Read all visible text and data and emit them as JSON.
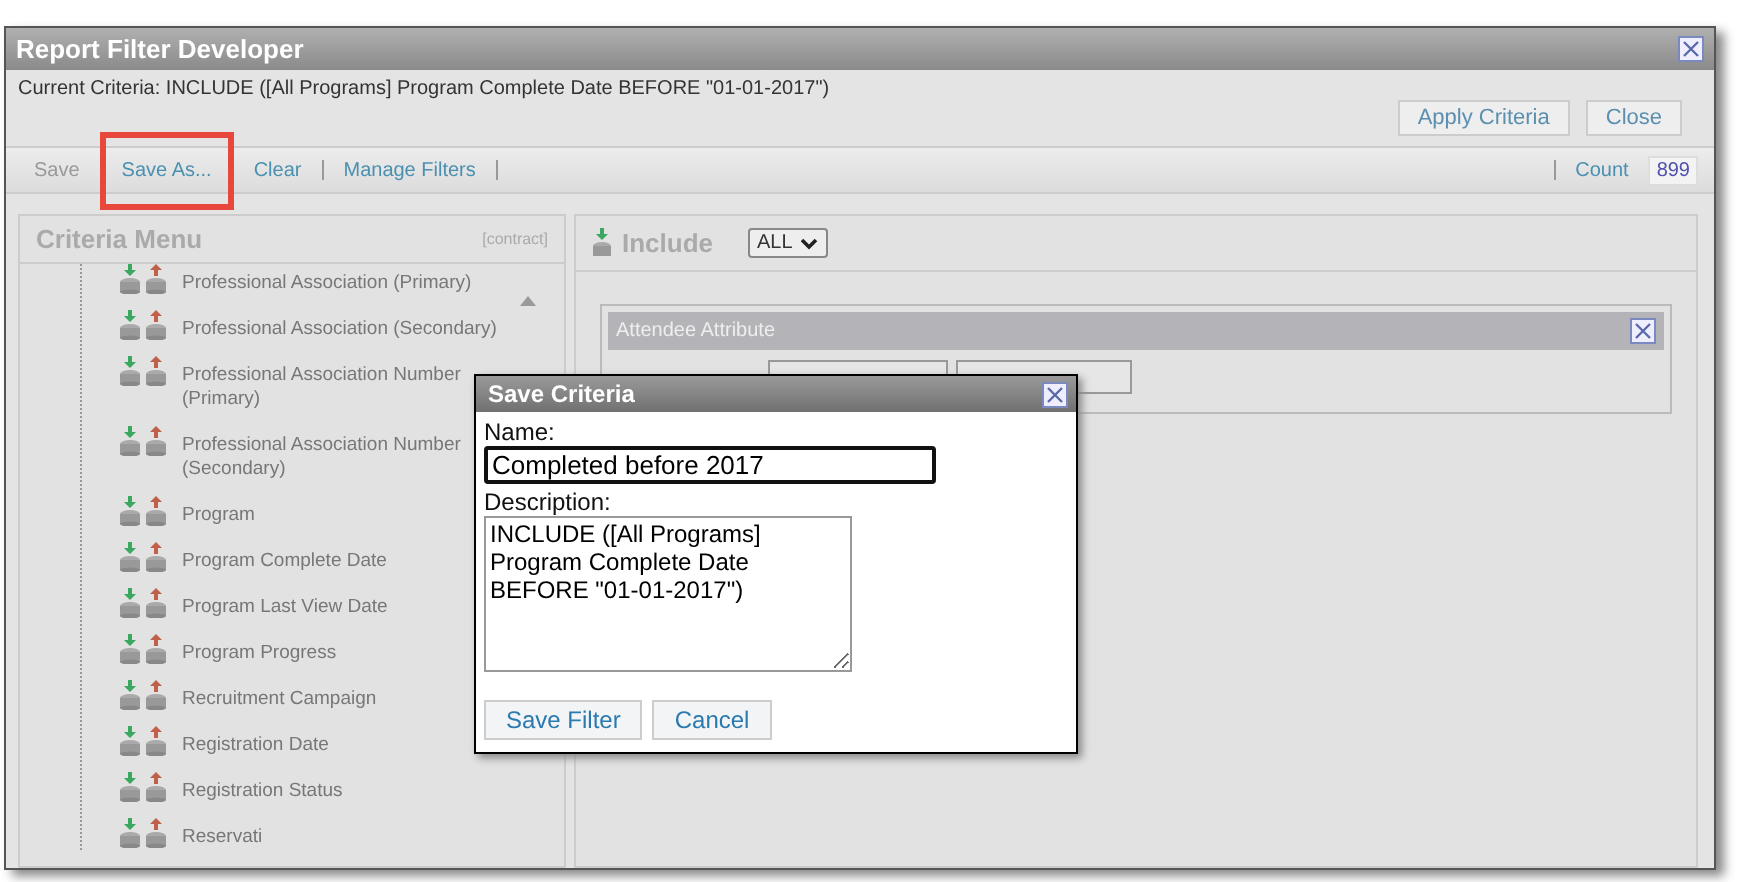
{
  "window": {
    "title": "Report Filter Developer"
  },
  "criteria": {
    "label": "Current Criteria:",
    "value": "INCLUDE ([All Programs] Program Complete Date BEFORE \"01-01-2017\")"
  },
  "header_buttons": [
    "Apply Criteria",
    "Close"
  ],
  "toolbar": {
    "links": [
      {
        "label": "Save",
        "disabled": true,
        "highlighted": false
      },
      {
        "label": "Save As...",
        "disabled": false,
        "highlighted": true
      },
      {
        "label": "Clear",
        "disabled": false,
        "highlighted": false
      },
      {
        "label": "Manage Filters",
        "disabled": false,
        "highlighted": false
      }
    ],
    "count_label": "Count",
    "count": "899"
  },
  "criteria_menu": {
    "title": "Criteria Menu",
    "toggle": "[contract]",
    "items": [
      {
        "label": "Professional Association (Primary)"
      },
      {
        "label": "Professional Association (Secondary)"
      },
      {
        "label": "Professional Association Number (Primary)"
      },
      {
        "label": "Professional Association Number (Secondary)"
      },
      {
        "label": "Program"
      },
      {
        "label": "Program Complete Date"
      },
      {
        "label": "Program Last View Date"
      },
      {
        "label": "Program Progress"
      },
      {
        "label": "Recruitment Campaign"
      },
      {
        "label": "Registration Date"
      },
      {
        "label": "Registration Status"
      },
      {
        "label": "Reservati"
      }
    ]
  },
  "include_panel": {
    "title": "Include",
    "mode": "ALL",
    "group": {
      "title": "Attendee Attribute"
    }
  },
  "dialog": {
    "title": "Save Criteria",
    "name_label": "Name:",
    "name_value": "Completed before 2017",
    "description_label": "Description:",
    "description_value": "INCLUDE ([All Programs]\nProgram Complete Date\nBEFORE \"01-01-2017\")",
    "buttons": [
      "Save Filter",
      "Cancel"
    ]
  }
}
